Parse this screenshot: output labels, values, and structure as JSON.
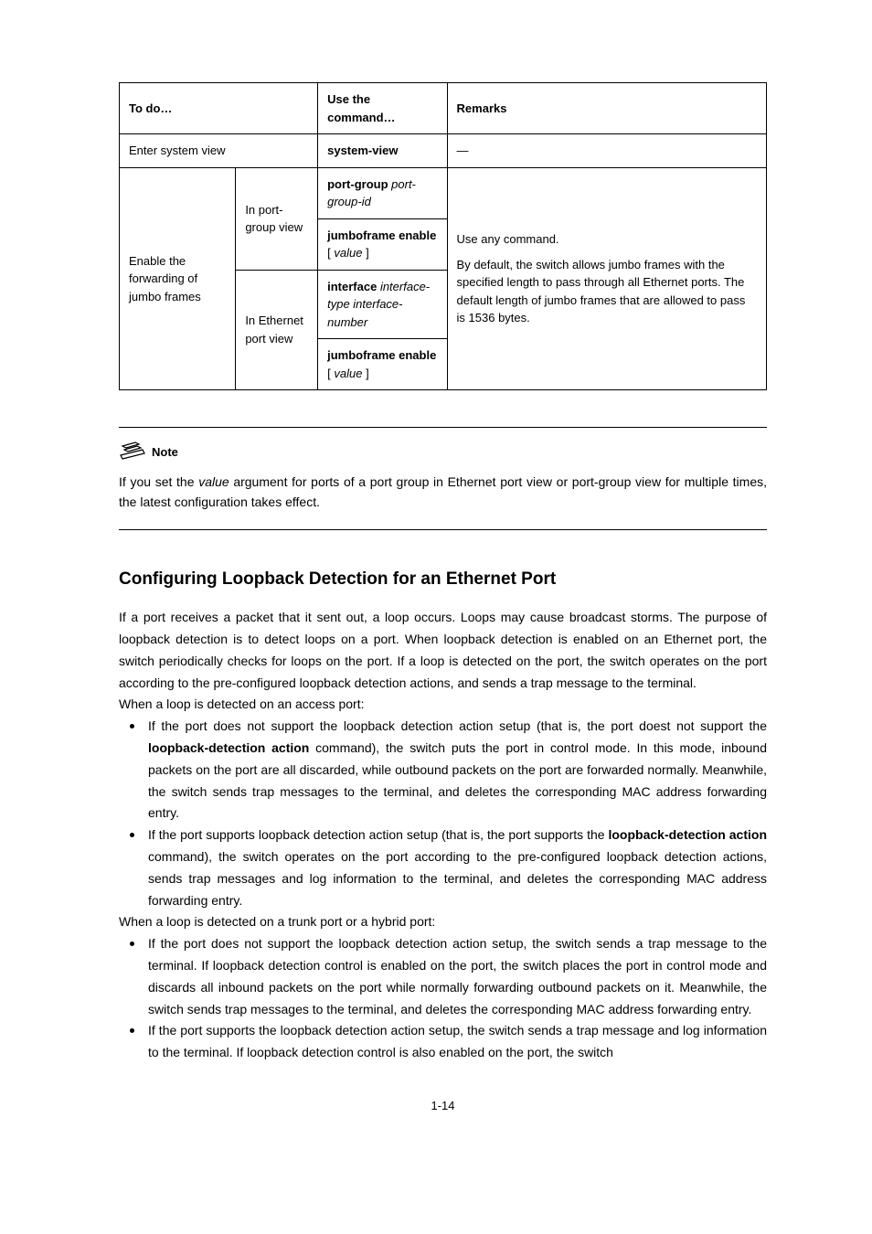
{
  "table": {
    "headers": {
      "c1": "To do…",
      "c2": "Use the command…",
      "c3": "Remarks"
    },
    "row1": {
      "step": "Enter system view",
      "cmd": "system-view",
      "remark": "—"
    },
    "row2": {
      "step": "Enable the forwarding of jumbo frames",
      "view1": "In port-group view",
      "view2": "In Ethernet port view",
      "c1a": "port-group",
      "c1b": "port-group-id",
      "c2a": "jumboframe enable",
      "c2b_open": "[",
      "c2b_val": "value",
      "c2b_close": "]",
      "c3a": "interface",
      "c3b": "interface-type interface-number",
      "c4a": "jumboframe enable",
      "c4b_open": "[",
      "c4b_val": "value",
      "c4b_close": "]",
      "remark_l1": "Use any command.",
      "remark_l2": "By default, the switch allows jumbo frames with the specified length to pass through all Ethernet ports. The default length of jumbo frames that are allowed to pass is 1536 bytes."
    }
  },
  "note": {
    "label": "Note",
    "body_a": "If you set the ",
    "body_b": "value",
    "body_c": " argument for ports of a port group in Ethernet port view or port-group view for multiple times, the latest configuration takes effect."
  },
  "heading": "Configuring Loopback Detection for an Ethernet Port",
  "para1": "If a port receives a packet that it sent out, a loop occurs. Loops may cause broadcast storms. The purpose of loopback detection is to detect loops on a port. When loopback detection is enabled on an Ethernet port, the switch periodically checks for loops on the port. If a loop is detected on the port, the switch operates on the port according to the pre-configured loopback detection actions, and sends a trap message to the terminal.",
  "para2": "When a loop is detected on an access port:",
  "bul1_a": "If the port does not support the loopback detection action setup (that is, the port doest not support the ",
  "bul1_cmd": "loopback-detection action",
  "bul1_b": " command), the switch puts the port in control mode. In this mode, inbound packets on the port are all discarded, while outbound packets on the port are forwarded normally. Meanwhile, the switch sends trap messages to the terminal, and deletes the corresponding MAC address forwarding entry.",
  "bul2_a": "If the port supports loopback detection action setup (that is, the port supports the ",
  "bul2_cmd": "loopback-detection action",
  "bul2_b": " command), the switch operates on the port according to the pre-configured loopback detection actions, sends trap messages and log information to the terminal, and deletes the corresponding MAC address forwarding entry.",
  "para3": "When a loop is detected on a trunk port or a hybrid port:",
  "bul3": "If the port does not support the loopback detection action setup, the switch sends a trap message to the terminal. If loopback detection control is enabled on the port, the switch places the port in control mode and discards all inbound packets on the port while normally forwarding outbound packets on it. Meanwhile, the switch sends trap messages to the terminal, and deletes the corresponding MAC address forwarding entry.",
  "bul4": "If the port supports the loopback detection action setup, the switch sends a trap message and log information to the terminal. If loopback detection control is also enabled on the port, the switch",
  "pagenum": "1-14"
}
